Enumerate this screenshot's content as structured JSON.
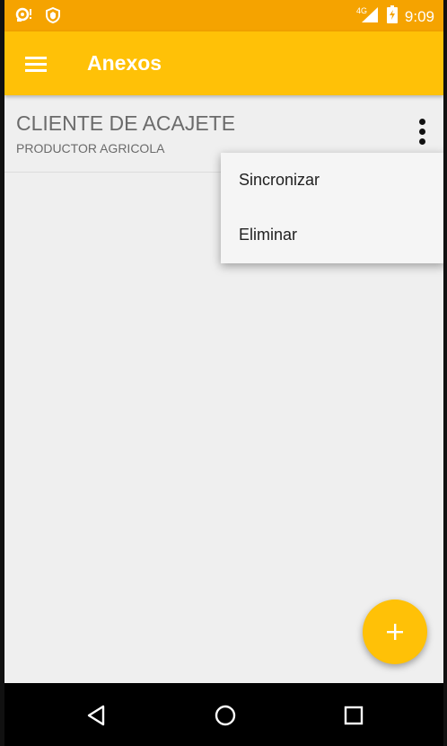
{
  "status_bar": {
    "time": "9:09",
    "network": "4G",
    "colors": {
      "background": "#f5a300"
    },
    "icons": [
      "notification-icon",
      "shield-icon",
      "signal-icon",
      "battery-icon"
    ]
  },
  "app_bar": {
    "title": "Anexos",
    "menu_icon": "hamburger-menu-icon",
    "colors": {
      "background": "#ffc107",
      "title": "#ffffff"
    }
  },
  "list": {
    "items": [
      {
        "title": "CLIENTE DE ACAJETE",
        "subtitle": "PRODUCTOR AGRICOLA",
        "overflow_icon": "more-vert-icon"
      }
    ]
  },
  "popup_menu": {
    "items": [
      {
        "label": "Sincronizar"
      },
      {
        "label": "Eliminar"
      }
    ]
  },
  "fab": {
    "icon": "plus-icon",
    "color": "#ffc107"
  },
  "nav_bar": {
    "icons": [
      "back-icon",
      "home-icon",
      "recents-icon"
    ]
  }
}
